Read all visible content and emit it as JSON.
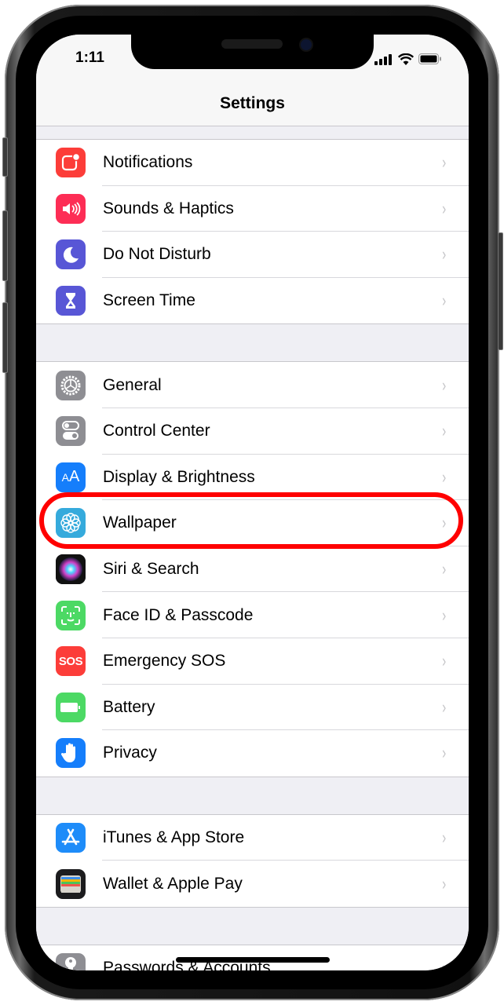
{
  "status_bar": {
    "time": "1:11",
    "signal_icon": "cellular-signal-icon",
    "wifi_icon": "wifi-icon",
    "battery_icon": "battery-icon"
  },
  "nav": {
    "title": "Settings"
  },
  "groups": [
    {
      "items": [
        {
          "label": "Notifications",
          "icon": "notifications-icon",
          "color": "#fc3d39"
        },
        {
          "label": "Sounds & Haptics",
          "icon": "speaker-icon",
          "color": "#fd2d55"
        },
        {
          "label": "Do Not Disturb",
          "icon": "moon-icon",
          "color": "#5856d6"
        },
        {
          "label": "Screen Time",
          "icon": "hourglass-icon",
          "color": "#5856d6"
        }
      ]
    },
    {
      "items": [
        {
          "label": "General",
          "icon": "gear-icon",
          "color": "#8e8e93"
        },
        {
          "label": "Control Center",
          "icon": "toggles-icon",
          "color": "#8e8e93"
        },
        {
          "label": "Display & Brightness",
          "icon": "text-size-icon",
          "color": "#157efb"
        },
        {
          "label": "Wallpaper",
          "icon": "flower-icon",
          "color": "#35aadc"
        },
        {
          "label": "Siri & Search",
          "icon": "siri-icon",
          "color": "#1c1c3a"
        },
        {
          "label": "Face ID & Passcode",
          "icon": "face-id-icon",
          "color": "#4cd964"
        },
        {
          "label": "Emergency SOS",
          "icon": "sos-icon",
          "color": "#fc3d39"
        },
        {
          "label": "Battery",
          "icon": "battery-icon",
          "color": "#4cd964"
        },
        {
          "label": "Privacy",
          "icon": "hand-icon",
          "color": "#157efb"
        }
      ]
    },
    {
      "items": [
        {
          "label": "iTunes & App Store",
          "icon": "app-store-icon",
          "color": "#1e8cf9"
        },
        {
          "label": "Wallet & Apple Pay",
          "icon": "wallet-icon",
          "color": "#1c1c1e"
        }
      ]
    },
    {
      "items": [
        {
          "label": "Passwords & Accounts",
          "icon": "key-icon",
          "color": "#8e8e93"
        }
      ]
    }
  ],
  "icon_text": {
    "sos": "SOS",
    "display": "AA"
  },
  "chevron": "›",
  "highlight": {
    "target": "Wallpaper",
    "color": "#ff0000"
  }
}
